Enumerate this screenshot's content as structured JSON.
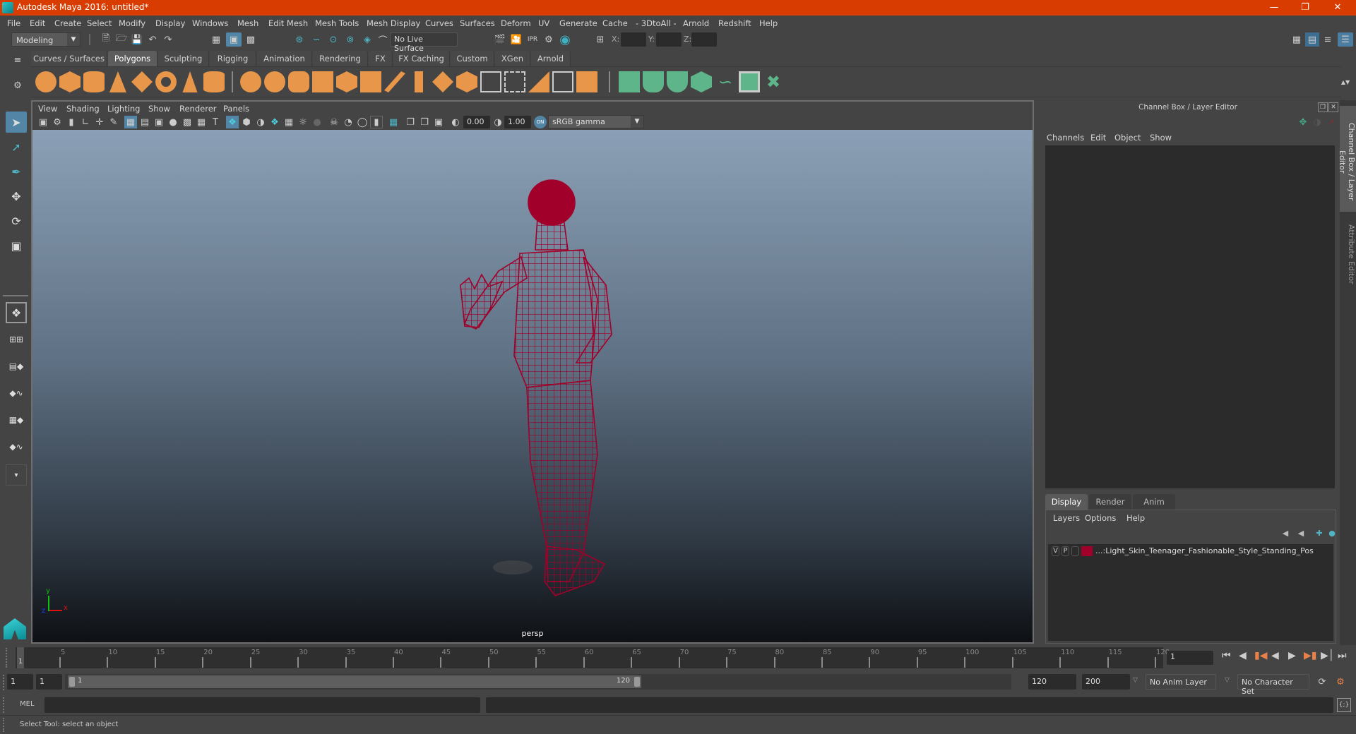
{
  "window": {
    "title": "Autodesk Maya 2016: untitled*",
    "controls": [
      "minimize",
      "restore",
      "close"
    ]
  },
  "menubar": [
    "File",
    "Edit",
    "Create",
    "Select",
    "Modify",
    "Display",
    "Windows",
    "Mesh",
    "Edit Mesh",
    "Mesh Tools",
    "Mesh Display",
    "Curves",
    "Surfaces",
    "Deform",
    "UV",
    "Generate",
    "Cache",
    "- 3DtoAll -",
    "Arnold",
    "Redshift",
    "Help"
  ],
  "statusline": {
    "mode": "Modeling",
    "live_surface": "No Live Surface",
    "x_label": "X:",
    "y_label": "Y:",
    "z_label": "Z:",
    "x": "",
    "y": "",
    "z": ""
  },
  "shelf": {
    "tabs": [
      "Curves / Surfaces",
      "Polygons",
      "Sculpting",
      "Rigging",
      "Animation",
      "Rendering",
      "FX",
      "FX Caching",
      "Custom",
      "XGen",
      "Arnold"
    ],
    "active_tab": "Polygons",
    "icons": [
      "poly-sphere",
      "poly-cube",
      "poly-cylinder",
      "poly-cone",
      "poly-plane",
      "poly-torus",
      "poly-pyramid",
      "poly-pipe",
      "combine",
      "separate",
      "mirror",
      "smooth",
      "extract",
      "bevel",
      "bridge",
      "extrude",
      "multi-cut",
      "target-weld",
      "append",
      "fill-hole",
      "merge",
      "boolean",
      "edge-loop",
      "insert-loop",
      "uv-planar",
      "uv-cylindrical",
      "uv-spherical",
      "uv-automatic",
      "uv-contour",
      "uv-editor",
      "uv-unfold"
    ]
  },
  "viewport": {
    "menu": [
      "View",
      "Shading",
      "Lighting",
      "Show",
      "Renderer",
      "Panels"
    ],
    "exposure": "0.00",
    "gamma": "1.00",
    "color_space": "sRGB gamma",
    "camera_label": "persp",
    "axis": {
      "x": "x",
      "y": "y",
      "z": "z"
    },
    "wireframe_color": "#a0002a"
  },
  "channel_box": {
    "title": "Channel Box / Layer Editor",
    "menu": [
      "Channels",
      "Edit",
      "Object",
      "Show"
    ]
  },
  "layer_editor": {
    "tabs": [
      "Display",
      "Render",
      "Anim"
    ],
    "active_tab": "Display",
    "menu": [
      "Layers",
      "Options",
      "Help"
    ],
    "layers": [
      {
        "v": "V",
        "p": "P",
        "color": "#a0002a",
        "name": "...:Light_Skin_Teenager_Fashionable_Style_Standing_Pos"
      }
    ]
  },
  "side_tabs": [
    "Channel Box / Layer Editor",
    "Attribute Editor"
  ],
  "timeline": {
    "ticks": [
      "5",
      "10",
      "15",
      "20",
      "25",
      "30",
      "35",
      "40",
      "45",
      "50",
      "55",
      "60",
      "65",
      "70",
      "75",
      "80",
      "85",
      "90",
      "95",
      "100",
      "105",
      "110",
      "115",
      "120"
    ],
    "current_frame_marker": "1",
    "current_frame": "1"
  },
  "range": {
    "start": "1",
    "playback_start": "1",
    "slider_start": "1",
    "slider_end": "120",
    "playback_end": "120",
    "end": "200",
    "anim_layer": "No Anim Layer",
    "character_set": "No Character Set"
  },
  "command_line": {
    "label": "MEL",
    "value": "",
    "result": ""
  },
  "help_line": "Select Tool: select an object"
}
